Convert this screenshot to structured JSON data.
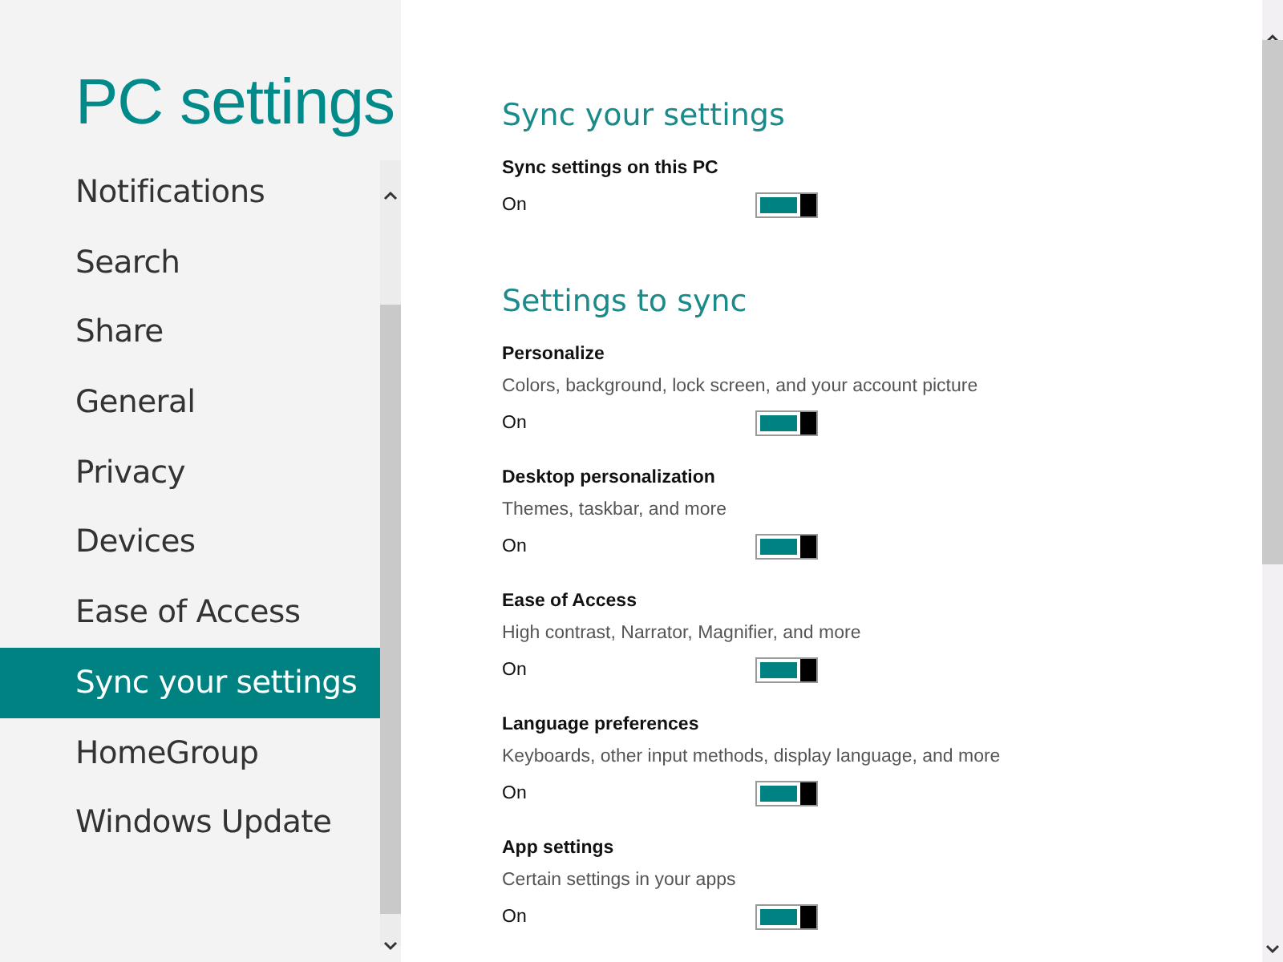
{
  "sidebar": {
    "title": "PC settings",
    "items": [
      {
        "label": "Notifications",
        "selected": false
      },
      {
        "label": "Search",
        "selected": false
      },
      {
        "label": "Share",
        "selected": false
      },
      {
        "label": "General",
        "selected": false
      },
      {
        "label": "Privacy",
        "selected": false
      },
      {
        "label": "Devices",
        "selected": false
      },
      {
        "label": "Ease of Access",
        "selected": false
      },
      {
        "label": "Sync your settings",
        "selected": true
      },
      {
        "label": "HomeGroup",
        "selected": false
      },
      {
        "label": "Windows Update",
        "selected": false
      }
    ]
  },
  "sections": [
    {
      "heading": "Sync your settings",
      "settings": [
        {
          "title": "Sync settings on this PC",
          "state_label": "On",
          "on": true
        }
      ]
    },
    {
      "heading": "Settings to sync",
      "settings": [
        {
          "title": "Personalize",
          "description": "Colors, background, lock screen, and your account picture",
          "state_label": "On",
          "on": true
        },
        {
          "title": "Desktop personalization",
          "description": "Themes, taskbar, and more",
          "state_label": "On",
          "on": true
        },
        {
          "title": "Ease of Access",
          "description": "High contrast, Narrator, Magnifier, and more",
          "state_label": "On",
          "on": true
        },
        {
          "title": "Language preferences",
          "description": "Keyboards, other input methods, display language, and more",
          "state_label": "On",
          "on": true
        },
        {
          "title": "App settings",
          "description": "Certain settings in your apps",
          "state_label": "On",
          "on": true
        }
      ]
    }
  ]
}
